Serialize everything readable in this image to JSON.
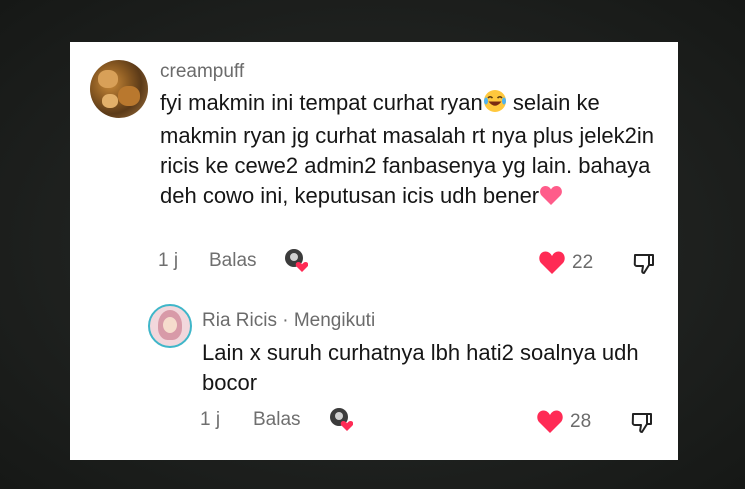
{
  "comments": [
    {
      "username": "creampuff",
      "text_before_emoji": "fyi makmin ini tempat curhat ryan",
      "text_after_emoji": " selain ke makmin ryan jg curhat masalah rt nya plus jelek2in ricis ke cewe2 admin2 fanbasenya yg lain. bahaya deh cowo ini, keputusan icis udh bener",
      "emoji_inline": "laughing-emoji",
      "emoji_end": "pink-heart-emoji",
      "time": "1 j",
      "reply_label": "Balas",
      "like_count": "22",
      "liked": true
    },
    {
      "username": "Ria Ricis",
      "separator": " · ",
      "follow_status": "Mengikuti",
      "text": "Lain x suruh curhatnya lbh hati2 soalnya udh bocor",
      "time": "1 j",
      "reply_label": "Balas",
      "like_count": "28",
      "liked": true
    }
  ],
  "colors": {
    "like_red": "#ff2b55",
    "muted_text": "#6b6b6b",
    "body_text": "#161616",
    "verified_ring": "#3fb6c9"
  }
}
